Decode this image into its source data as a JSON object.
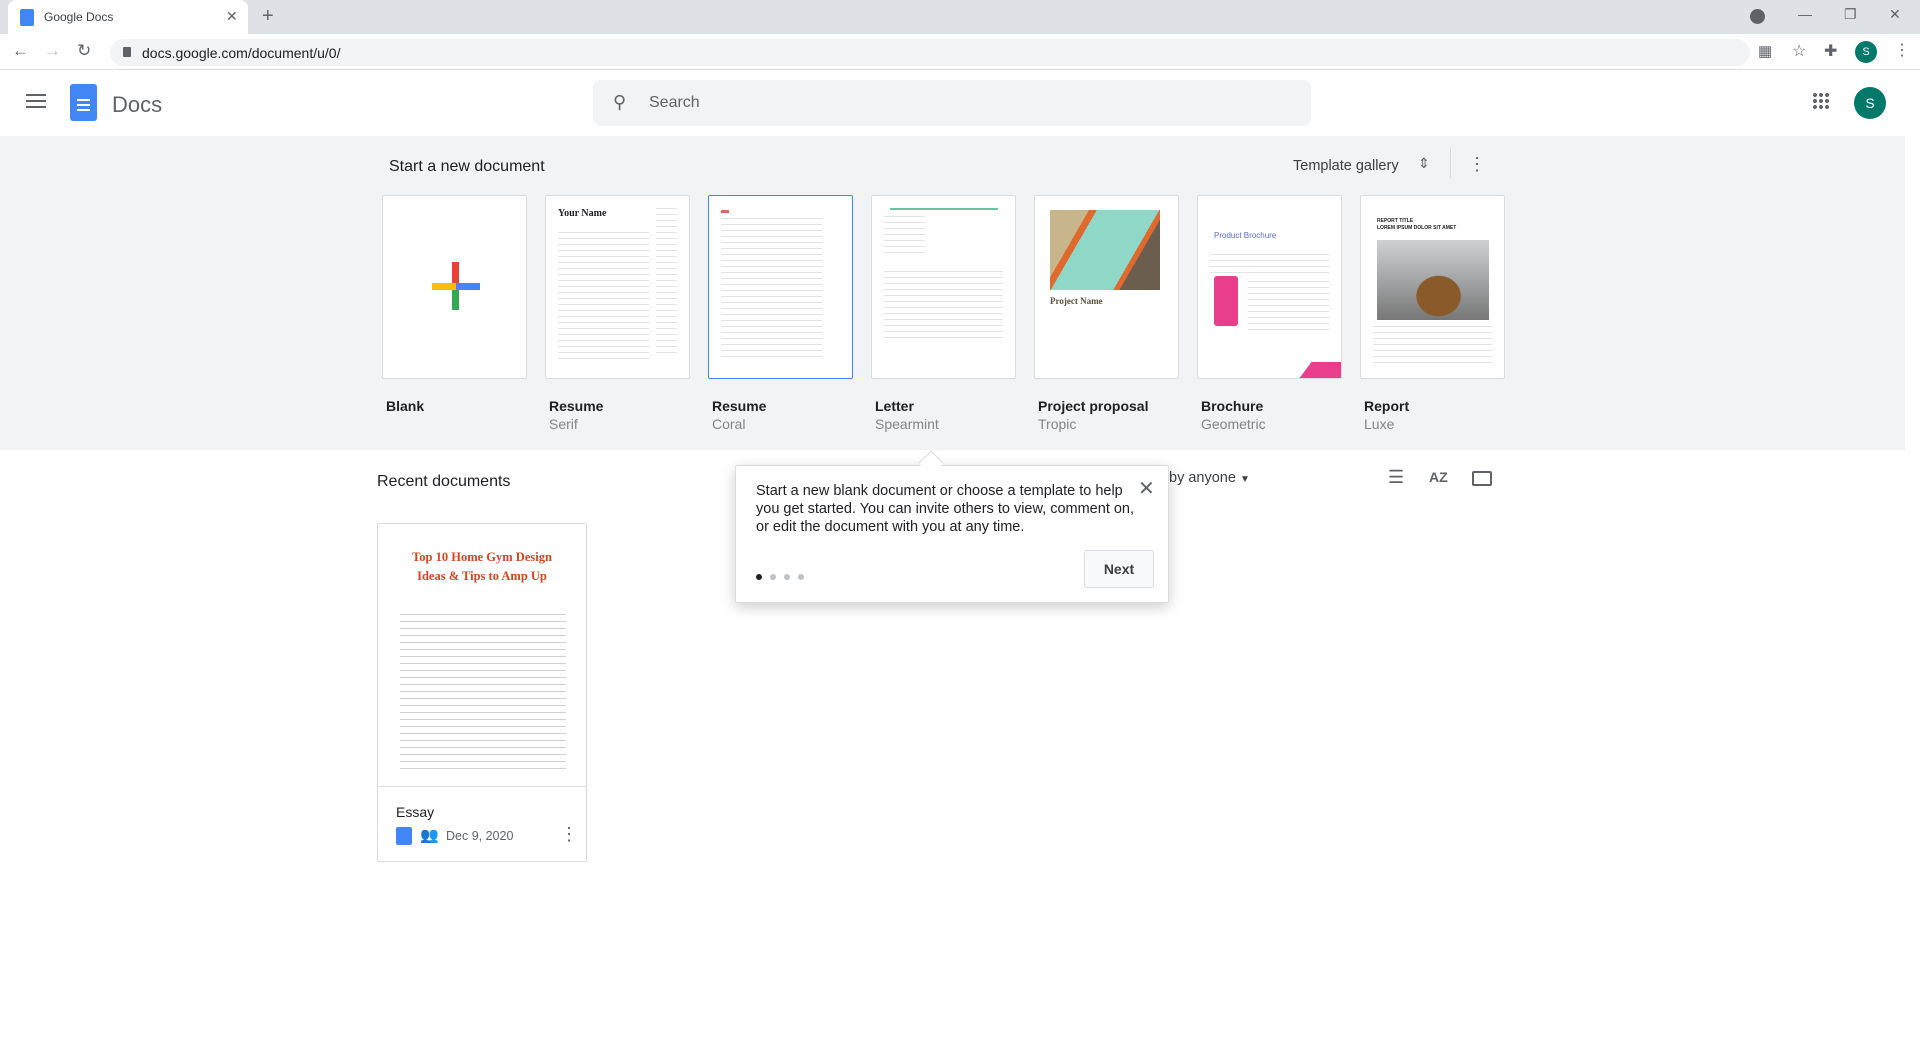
{
  "browser": {
    "tab_title": "Google Docs",
    "url": "docs.google.com/document/u/0/",
    "profile_initial": "S"
  },
  "header": {
    "app_name": "Docs",
    "search_placeholder": "Search",
    "avatar_initial": "S"
  },
  "templates": {
    "heading": "Start a new document",
    "gallery_label": "Template gallery",
    "items": [
      {
        "name": "Blank",
        "sub": ""
      },
      {
        "name": "Resume",
        "sub": "Serif"
      },
      {
        "name": "Resume",
        "sub": "Coral"
      },
      {
        "name": "Letter",
        "sub": "Spearmint"
      },
      {
        "name": "Project proposal",
        "sub": "Tropic"
      },
      {
        "name": "Brochure",
        "sub": "Geometric"
      },
      {
        "name": "Report",
        "sub": "Luxe"
      }
    ],
    "thumb_text": {
      "your_name": "Your Name",
      "project_name": "Project Name",
      "product_brochure": "Product Brochure",
      "report_title": "REPORT TITLE",
      "report_sub": "LOREM IPSUM DOLOR SIT AMET"
    }
  },
  "recent": {
    "heading": "Recent documents",
    "owner_filter": "by anyone",
    "docs": [
      {
        "preview_title": "Top 10 Home Gym Design Ideas & Tips to Amp Up",
        "name": "Essay",
        "date": "Dec 9, 2020"
      }
    ]
  },
  "tooltip": {
    "text": "Start a new blank document or choose a template to help you get started. You can invite others to view, comment on, or edit the document with you at any time.",
    "next_label": "Next",
    "step": 1,
    "steps": 4
  },
  "colors": {
    "accent": "#4285f4",
    "avatar": "#00796b",
    "template_bg": "#f1f3f4"
  }
}
